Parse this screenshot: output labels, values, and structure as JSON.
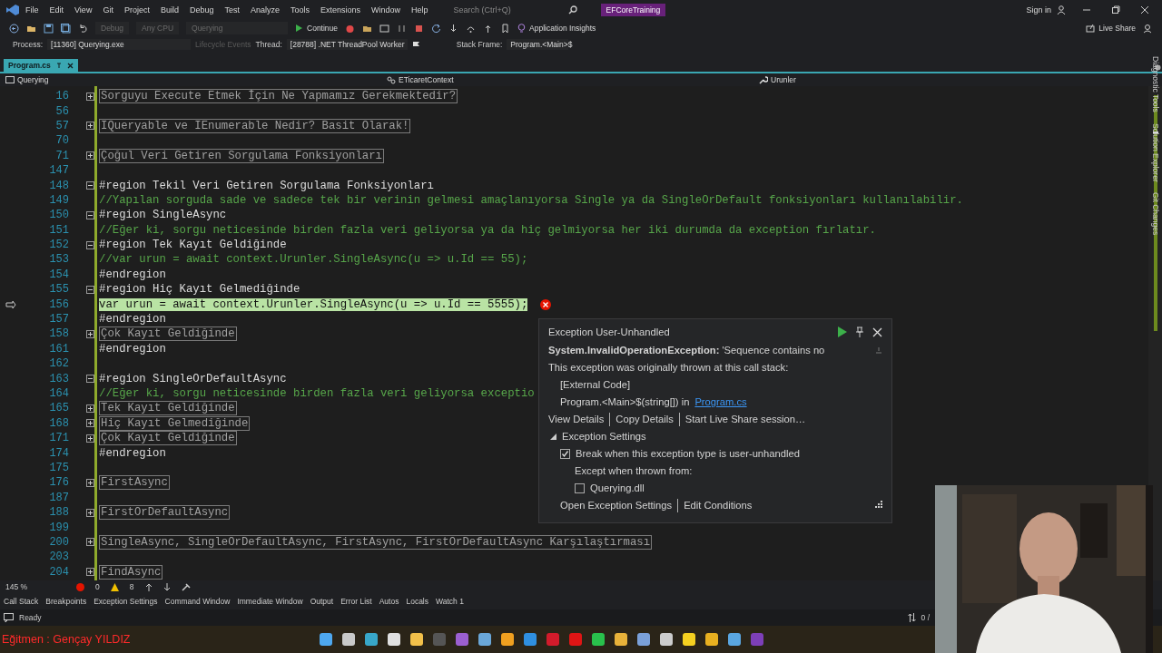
{
  "title_bar": {
    "menu": [
      "File",
      "Edit",
      "View",
      "Git",
      "Project",
      "Build",
      "Debug",
      "Test",
      "Analyze",
      "Tools",
      "Extensions",
      "Window",
      "Help"
    ],
    "search": {
      "placeholder": "Search (Ctrl+Q)"
    },
    "solution": "EFCoreTraining",
    "sign_in": "Sign in"
  },
  "toolbar": {
    "configuration": "Debug",
    "platform": "Any CPU",
    "startup": "Querying",
    "continue": "Continue",
    "insights": "Application Insights",
    "live_share": "Live Share"
  },
  "debug_location": {
    "process_label": "Process:",
    "process": "[11360] Querying.exe",
    "lifecycle": "Lifecycle Events",
    "thread_label": "Thread:",
    "thread": "[28788] .NET ThreadPool Worker",
    "stack_label": "Stack Frame:",
    "stack_frame": "Program.<Main>$"
  },
  "tabs": [
    {
      "label": "Program.cs",
      "selected": true
    }
  ],
  "nav_bar": {
    "project": "Querying",
    "type": "ETicaretContext",
    "member": "Urunler"
  },
  "code_lines": [
    {
      "number": "16",
      "kind": "collapsed",
      "text": "Sorguyu Execute Etmek İçin Ne Yapmamız Gerekmektedir?"
    },
    {
      "number": "56",
      "kind": "blank"
    },
    {
      "number": "57",
      "kind": "collapsed",
      "text": "IQueryable ve IEnumerable Nedir? Basit Olarak!"
    },
    {
      "number": "70",
      "kind": "blank"
    },
    {
      "number": "71",
      "kind": "collapsed",
      "text": "Çoğul Veri Getiren Sorgulama Fonksiyonları"
    },
    {
      "number": "147",
      "kind": "blank"
    },
    {
      "number": "148",
      "kind": "region",
      "text": "#region Tekil Veri Getiren Sorgulama Fonksiyonları"
    },
    {
      "number": "149",
      "kind": "comment",
      "text": "//Yapılan sorguda sade ve sadece tek bir verinin gelmesi amaçlanıyorsa Single ya da SingleOrDefault fonksiyonları kullanılabilir."
    },
    {
      "number": "150",
      "kind": "region",
      "text": "#region SingleAsync"
    },
    {
      "number": "151",
      "kind": "comment",
      "text": "//Eğer ki, sorgu neticesinde birden fazla veri geliyorsa ya da hiç gelmiyorsa her iki durumda da exception fırlatır."
    },
    {
      "number": "152",
      "kind": "region",
      "text": "#region Tek Kayıt Geldiğinde"
    },
    {
      "number": "153",
      "kind": "comment",
      "text": "//var urun = await context.Urunler.SingleAsync(u => u.Id == 55);"
    },
    {
      "number": "154",
      "kind": "endregion",
      "text": "#endregion"
    },
    {
      "number": "155",
      "kind": "region",
      "text": "#region Hiç Kayıt Gelmediğinde"
    },
    {
      "number": "156",
      "kind": "current",
      "text": "var urun = await context.Urunler.SingleAsync(u => u.Id == 5555);"
    },
    {
      "number": "157",
      "kind": "endregion",
      "text": "#endregion"
    },
    {
      "number": "158",
      "kind": "collapsed",
      "text": "Çok Kayıt Geldiğinde"
    },
    {
      "number": "161",
      "kind": "endregion",
      "text": "#endregion"
    },
    {
      "number": "162",
      "kind": "blank"
    },
    {
      "number": "163",
      "kind": "region",
      "text": "#region SingleOrDefaultAsync"
    },
    {
      "number": "164",
      "kind": "comment",
      "text": "//Eğer ki, sorgu neticesinde birden fazla veri geliyorsa exceptio"
    },
    {
      "number": "165",
      "kind": "collapsed",
      "text": "Tek Kayıt Geldiğinde"
    },
    {
      "number": "168",
      "kind": "collapsed",
      "text": "Hiç Kayıt Gelmediğinde"
    },
    {
      "number": "171",
      "kind": "collapsed",
      "text": "Çok Kayıt Geldiğinde"
    },
    {
      "number": "174",
      "kind": "endregion",
      "text": "#endregion"
    },
    {
      "number": "175",
      "kind": "blank"
    },
    {
      "number": "176",
      "kind": "collapsed",
      "text": "FirstAsync"
    },
    {
      "number": "187",
      "kind": "blank"
    },
    {
      "number": "188",
      "kind": "collapsed",
      "text": "FirstOrDefaultAsync"
    },
    {
      "number": "199",
      "kind": "blank"
    },
    {
      "number": "200",
      "kind": "collapsed",
      "text": "SingleAsync, SingleOrDefaultAsync, FirstAsync, FirstOrDefaultAsync Karşılaştırması"
    },
    {
      "number": "203",
      "kind": "blank"
    },
    {
      "number": "204",
      "kind": "collapsed",
      "text": "FindAsync"
    }
  ],
  "exception": {
    "title": "Exception User-Unhandled",
    "type": "System.InvalidOperationException:",
    "message": "'Sequence contains no",
    "intro": "This exception was originally thrown at this call stack:",
    "stack": [
      {
        "text": "[External Code]"
      },
      {
        "text": "Program.<Main>$(string[]) in",
        "link": "Program.cs"
      }
    ],
    "links": [
      "View Details",
      "Copy Details",
      "Start Live Share session…"
    ],
    "settings_title": "Exception Settings",
    "expanded": true,
    "break_option": {
      "label": "Break when this exception type is user-unhandled",
      "checked": true
    },
    "except_label": "Except when thrown from:",
    "modules": [
      {
        "label": "Querying.dll",
        "checked": false
      }
    ],
    "footer_links": [
      "Open Exception Settings",
      "Edit Conditions"
    ]
  },
  "editor_footer": {
    "zoom": "145 %",
    "errors": "0",
    "warnings": "8"
  },
  "tool_tabs": [
    "Call Stack",
    "Breakpoints",
    "Exception Settings",
    "Command Window",
    "Immediate Window",
    "Output",
    "Error List",
    "Autos",
    "Locals",
    "Watch 1"
  ],
  "side_tabs": [
    "Diagnostic Tools",
    "Solution Explorer",
    "Git Changes"
  ],
  "status": {
    "text": "Ready",
    "position": "0 /"
  },
  "caption": "Eğitmen : Gençay YILDIZ"
}
